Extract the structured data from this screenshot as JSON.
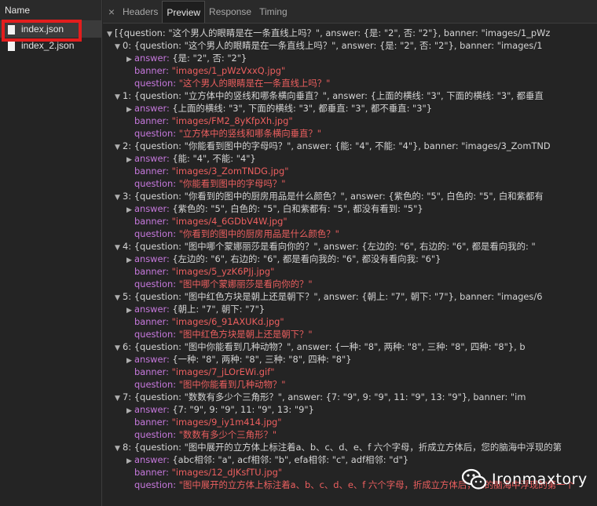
{
  "left_panel": {
    "header": "Name",
    "files": [
      {
        "name": "index.json",
        "selected": true
      },
      {
        "name": "index_2.json",
        "selected": false
      }
    ]
  },
  "tabs": [
    {
      "label": "Headers",
      "active": false
    },
    {
      "label": "Preview",
      "active": true
    },
    {
      "label": "Response",
      "active": false
    },
    {
      "label": "Timing",
      "active": false
    }
  ],
  "close_glyph": "×",
  "preview": {
    "root": "[{question: \"这个男人的眼睛是在一条直线上吗？\", answer: {是: \"2\", 否: \"2\"}, banner: \"images/1_pWz",
    "items": [
      {
        "summary": "0: {question: \"这个男人的眼睛是在一条直线上吗？\", answer: {是: \"2\", 否: \"2\"}, banner: \"images/1",
        "answer": "{是: \"2\", 否: \"2\"}",
        "banner": "\"images/1_pWzVxxQ.jpg\"",
        "question": "\"这个男人的眼睛是在一条直线上吗？\""
      },
      {
        "summary": "1: {question: \"立方体中的竖线和哪条横向垂直？\", answer: {上面的横线: \"3\", 下面的横线: \"3\", 都垂直",
        "answer": "{上面的横线: \"3\", 下面的横线: \"3\", 都垂直: \"3\", 都不垂直: \"3\"}",
        "banner": "\"images/FM2_8yKfpXh.jpg\"",
        "question": "\"立方体中的竖线和哪条横向垂直？\""
      },
      {
        "summary": "2: {question: \"你能看到图中的字母吗？\", answer: {能: \"4\", 不能: \"4\"}, banner: \"images/3_ZomTND",
        "answer": "{能: \"4\", 不能: \"4\"}",
        "banner": "\"images/3_ZomTNDG.jpg\"",
        "question": "\"你能看到图中的字母吗？\""
      },
      {
        "summary": "3: {question: \"你看到的图中的厨房用品是什么颜色？\", answer: {紫色的: \"5\", 白色的: \"5\", 白和紫都有",
        "answer": "{紫色的: \"5\", 白色的: \"5\", 白和紫都有: \"5\", 都没有看到: \"5\"}",
        "banner": "\"images/4_6GDbV4W.jpg\"",
        "question": "\"你看到的图中的厨房用品是什么颜色？\""
      },
      {
        "summary": "4: {question: \"图中哪个蒙娜丽莎是看向你的？\", answer: {左边的: \"6\", 右边的: \"6\", 都是看向我的: \"",
        "answer": "{左边的: \"6\", 右边的: \"6\", 都是看向我的: \"6\", 都没有看向我: \"6\"}",
        "banner": "\"images/5_yzK6PJj.jpg\"",
        "question": "\"图中哪个蒙娜丽莎是看向你的？\""
      },
      {
        "summary": "5: {question: \"图中红色方块是朝上还是朝下？\", answer: {朝上: \"7\", 朝下: \"7\"}, banner: \"images/6",
        "answer": "{朝上: \"7\", 朝下: \"7\"}",
        "banner": "\"images/6_91AXUKd.jpg\"",
        "question": "\"图中红色方块是朝上还是朝下？\""
      },
      {
        "summary": "6: {question: \"图中你能看到几种动物？\", answer: {一种: \"8\", 两种: \"8\", 三种: \"8\", 四种: \"8\"}, b",
        "answer": "{一种: \"8\", 两种: \"8\", 三种: \"8\", 四种: \"8\"}",
        "banner": "\"images/7_jLOrEWi.gif\"",
        "question": "\"图中你能看到几种动物？\""
      },
      {
        "summary": "7: {question: \"数数有多少个三角形？\", answer: {7: \"9\", 9: \"9\", 11: \"9\", 13: \"9\"}, banner: \"im",
        "answer": "{7: \"9\", 9: \"9\", 11: \"9\", 13: \"9\"}",
        "banner": "\"images/9_iy1m414.jpg\"",
        "question": "\"数数有多少个三角形？\""
      },
      {
        "summary": "8: {question: \"图中展开的立方体上标注着a、b、c、d、e、f 六个字母，折成立方体后，您的脑海中浮现的第",
        "answer": "{abc相邻: \"a\", acf相邻: \"b\", efa相邻: \"c\", adf相邻: \"d\"}",
        "banner": "\"images/12_dJKsfTU.jpg\"",
        "question": "\"图中展开的立方体上标注着a、b、c、d、e、f 六个字母，折成立方体后，您的脑海中浮现的第一个"
      }
    ]
  },
  "keys": {
    "answer": "answer:",
    "banner": "banner:",
    "question": "question:"
  },
  "watermark": {
    "text": "Ironmaxtory",
    "icon": "wechat-icon"
  },
  "colors": {
    "string": "#ec5f5f",
    "key": "#c678dd",
    "highlight": "#e31d1d"
  }
}
